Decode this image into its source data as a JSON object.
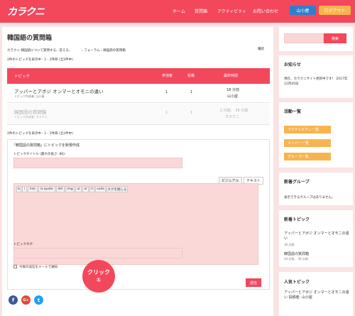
{
  "header": {
    "logo": "カラクニ",
    "nav": [
      "ホーム",
      "質問箱",
      "アクティビティ",
      "お問い合わせ"
    ],
    "user_button": "山小屋",
    "logout_button": "ログアウト"
  },
  "main": {
    "title": "韓国語の質問箱",
    "description": "カラクニ-韓国語について質問する、答える。",
    "breadcrumb": "› フォーラム › 韓国語の質問箱",
    "subscribe": "購読",
    "count_top": "2件のトピックを表示中 - 1 - 2件目 (全2件中)",
    "count_bottom": "2件のトピックを表示中 - 1 - 2件目 (全2件中)",
    "table": {
      "headers": [
        "トピック",
        "参加者",
        "投稿",
        "最終時間"
      ],
      "rows": [
        {
          "title": "アッパーとアボジ オンマーとオモニの違い",
          "author": "トピック作成者: 山小屋",
          "participants": "1",
          "posts": "1",
          "time": "18 分前",
          "by": "山小屋"
        },
        {
          "title": "韓国語の質問箱",
          "author": "トピック作成者: カラクニ",
          "participants": "1",
          "posts": "1",
          "time": "2 分前、 26 分前",
          "by": "カラクニ"
        }
      ]
    },
    "form": {
      "legend": "「韓国語の質問箱」にトピックを新規作成",
      "title_label": "トピックタイトル (最大の長さ: 80):",
      "visual_tab": "ビジュアル",
      "text_tab": "テキスト",
      "toolbar": [
        "b",
        "i",
        "link",
        "b-quote",
        "del",
        "img",
        "ul",
        "ol",
        "li",
        "code",
        "タグを閉じる"
      ],
      "tag_label": "トピックタグ:",
      "notify_label": "今後の返信をメールで通知",
      "submit": "送信"
    },
    "social": [
      "f",
      "G+",
      "t"
    ]
  },
  "sidebar": {
    "search_button": "検索",
    "notice_title": "お知らせ",
    "notice_text": "現在、カラクニサイト更新中です！ 2017年12月20日",
    "activity_title": "活動一覧",
    "activity_buttons": [
      "アクティビティー覧",
      "メンバー一覧",
      "グループ一覧"
    ],
    "new_groups_title": "新着グループ",
    "new_groups_text": "表示できるグループはありません。",
    "new_topics_title": "新着トピック",
    "new_topics": [
      {
        "title": "アッパーとアボジ オンマーとオモニの違い",
        "time": "18 分前"
      },
      {
        "title": "韓国語の質問箱",
        "time": "24 分前、 26 分前"
      }
    ],
    "popular_title": "人気トピック",
    "popular_topics": [
      {
        "title": "アッパーとアボジ オンマーとオモニの違い 投稿者: 山小屋"
      }
    ]
  },
  "annotation": {
    "label": "クリック",
    "number": "①"
  },
  "colors": {
    "brand": "#f3475c",
    "pink_field": "#fbd8d8",
    "orange_button": "#f7b44e",
    "user_button": "#2f7fcf"
  }
}
